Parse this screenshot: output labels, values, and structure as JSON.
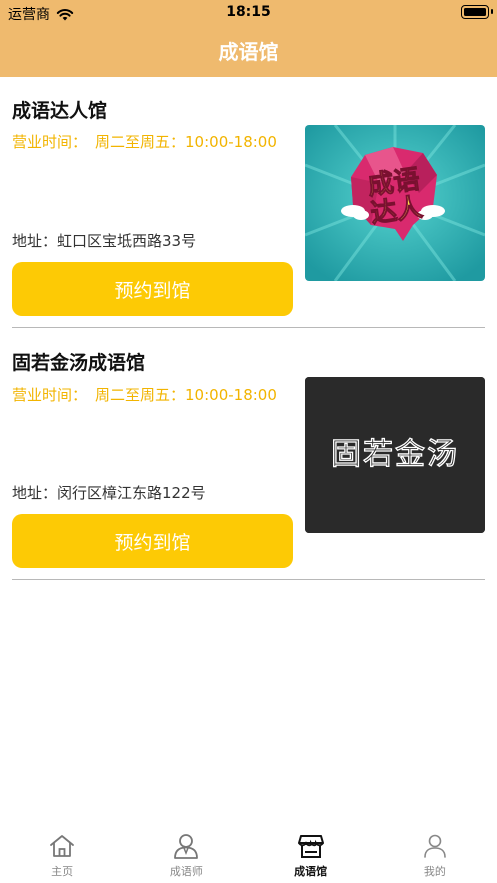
{
  "status_bar": {
    "carrier": "运营商",
    "time": "18:15"
  },
  "nav": {
    "title": "成语馆"
  },
  "venues": [
    {
      "name": "成语达人馆",
      "hours_label": "营业时间：",
      "hours_value": "周二至周五：10:00-18:00",
      "address_label": "地址：",
      "address_value": "虹口区宝坻西路33号",
      "book_label": "预约到馆",
      "image_text_top": "成语",
      "image_text_bottom": "达人"
    },
    {
      "name": "固若金汤成语馆",
      "hours_label": "营业时间：",
      "hours_value": "周二至周五：10:00-18:00",
      "address_label": "地址：",
      "address_value": "闵行区樟江东路122号",
      "book_label": "预约到馆",
      "image_text": "固若金汤"
    }
  ],
  "tabbar": [
    {
      "label": "主页",
      "icon": "home-icon"
    },
    {
      "label": "成语师",
      "icon": "person-icon"
    },
    {
      "label": "成语馆",
      "icon": "store-icon",
      "active": true
    },
    {
      "label": "我的",
      "icon": "user-icon"
    }
  ],
  "colors": {
    "header": "#efba6e",
    "button": "#fdca05",
    "hours_text": "#f2b400"
  }
}
